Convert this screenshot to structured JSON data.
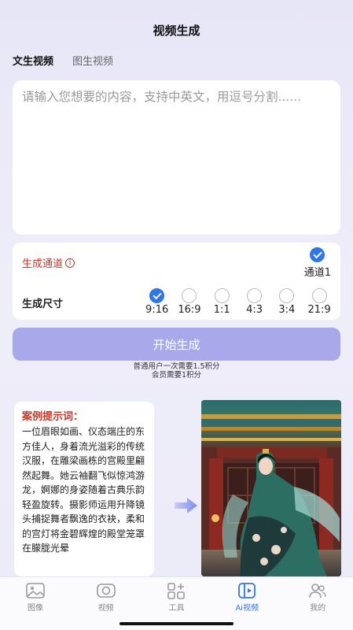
{
  "header": {
    "title": "视频生成"
  },
  "tabs": [
    {
      "label": "文生视频"
    },
    {
      "label": "图生视频"
    }
  ],
  "prompt": {
    "value": "",
    "placeholder": "请输入您想要的内容，支持中英文，用逗号分割......"
  },
  "channel": {
    "label": "生成通道",
    "info_icon": "info-icon",
    "option": "通道1"
  },
  "size": {
    "label": "生成尺寸",
    "options": [
      "9:16",
      "16:9",
      "1:1",
      "4:3",
      "3:4",
      "21:9"
    ],
    "selected": "9:16"
  },
  "generate_button": {
    "label": "开始生成"
  },
  "cost": {
    "line1": "普通用户一次需要1.5积分",
    "line2": "会员需要1积分"
  },
  "example": {
    "title": "案例提示词：",
    "text": "一位眉眼如画、仪态端庄的东方佳人，身着流光溢彩的传统汉服，在雕梁画栋的宫殿里翩然起舞。她云袖翻飞似惊鸿游龙，婀娜的身姿随着古典乐韵轻盈旋转。摄影师运用升降镜头捕捉舞者飘逸的衣袂，柔和的宫灯将金碧辉煌的殿堂笼罩在朦胧光晕"
  },
  "tabbar": [
    {
      "label": "图像",
      "icon": "image-icon"
    },
    {
      "label": "视频",
      "icon": "video-icon"
    },
    {
      "label": "工具",
      "icon": "tools-icon"
    },
    {
      "label": "Ai视频",
      "icon": "ai-video-icon",
      "active": true
    },
    {
      "label": "我的",
      "icon": "profile-icon"
    }
  ],
  "colors": {
    "accent": "#2f76e8",
    "button": "#a8a8ea",
    "alert": "#c0392b"
  }
}
